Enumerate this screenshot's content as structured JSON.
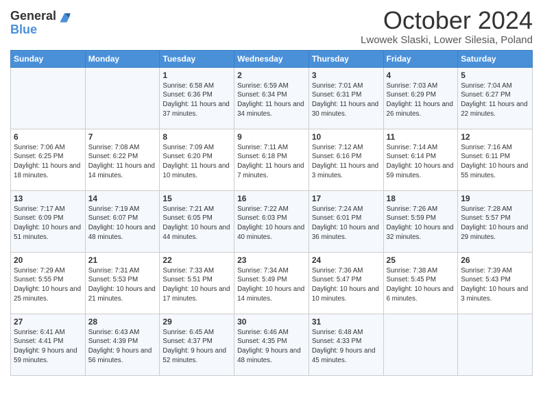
{
  "logo": {
    "general": "General",
    "blue": "Blue"
  },
  "title": "October 2024",
  "location": "Lwowek Slaski, Lower Silesia, Poland",
  "weekdays": [
    "Sunday",
    "Monday",
    "Tuesday",
    "Wednesday",
    "Thursday",
    "Friday",
    "Saturday"
  ],
  "weeks": [
    [
      {
        "day": "",
        "info": ""
      },
      {
        "day": "",
        "info": ""
      },
      {
        "day": "1",
        "info": "Sunrise: 6:58 AM\nSunset: 6:36 PM\nDaylight: 11 hours and 37 minutes."
      },
      {
        "day": "2",
        "info": "Sunrise: 6:59 AM\nSunset: 6:34 PM\nDaylight: 11 hours and 34 minutes."
      },
      {
        "day": "3",
        "info": "Sunrise: 7:01 AM\nSunset: 6:31 PM\nDaylight: 11 hours and 30 minutes."
      },
      {
        "day": "4",
        "info": "Sunrise: 7:03 AM\nSunset: 6:29 PM\nDaylight: 11 hours and 26 minutes."
      },
      {
        "day": "5",
        "info": "Sunrise: 7:04 AM\nSunset: 6:27 PM\nDaylight: 11 hours and 22 minutes."
      }
    ],
    [
      {
        "day": "6",
        "info": "Sunrise: 7:06 AM\nSunset: 6:25 PM\nDaylight: 11 hours and 18 minutes."
      },
      {
        "day": "7",
        "info": "Sunrise: 7:08 AM\nSunset: 6:22 PM\nDaylight: 11 hours and 14 minutes."
      },
      {
        "day": "8",
        "info": "Sunrise: 7:09 AM\nSunset: 6:20 PM\nDaylight: 11 hours and 10 minutes."
      },
      {
        "day": "9",
        "info": "Sunrise: 7:11 AM\nSunset: 6:18 PM\nDaylight: 11 hours and 7 minutes."
      },
      {
        "day": "10",
        "info": "Sunrise: 7:12 AM\nSunset: 6:16 PM\nDaylight: 11 hours and 3 minutes."
      },
      {
        "day": "11",
        "info": "Sunrise: 7:14 AM\nSunset: 6:14 PM\nDaylight: 10 hours and 59 minutes."
      },
      {
        "day": "12",
        "info": "Sunrise: 7:16 AM\nSunset: 6:11 PM\nDaylight: 10 hours and 55 minutes."
      }
    ],
    [
      {
        "day": "13",
        "info": "Sunrise: 7:17 AM\nSunset: 6:09 PM\nDaylight: 10 hours and 51 minutes."
      },
      {
        "day": "14",
        "info": "Sunrise: 7:19 AM\nSunset: 6:07 PM\nDaylight: 10 hours and 48 minutes."
      },
      {
        "day": "15",
        "info": "Sunrise: 7:21 AM\nSunset: 6:05 PM\nDaylight: 10 hours and 44 minutes."
      },
      {
        "day": "16",
        "info": "Sunrise: 7:22 AM\nSunset: 6:03 PM\nDaylight: 10 hours and 40 minutes."
      },
      {
        "day": "17",
        "info": "Sunrise: 7:24 AM\nSunset: 6:01 PM\nDaylight: 10 hours and 36 minutes."
      },
      {
        "day": "18",
        "info": "Sunrise: 7:26 AM\nSunset: 5:59 PM\nDaylight: 10 hours and 32 minutes."
      },
      {
        "day": "19",
        "info": "Sunrise: 7:28 AM\nSunset: 5:57 PM\nDaylight: 10 hours and 29 minutes."
      }
    ],
    [
      {
        "day": "20",
        "info": "Sunrise: 7:29 AM\nSunset: 5:55 PM\nDaylight: 10 hours and 25 minutes."
      },
      {
        "day": "21",
        "info": "Sunrise: 7:31 AM\nSunset: 5:53 PM\nDaylight: 10 hours and 21 minutes."
      },
      {
        "day": "22",
        "info": "Sunrise: 7:33 AM\nSunset: 5:51 PM\nDaylight: 10 hours and 17 minutes."
      },
      {
        "day": "23",
        "info": "Sunrise: 7:34 AM\nSunset: 5:49 PM\nDaylight: 10 hours and 14 minutes."
      },
      {
        "day": "24",
        "info": "Sunrise: 7:36 AM\nSunset: 5:47 PM\nDaylight: 10 hours and 10 minutes."
      },
      {
        "day": "25",
        "info": "Sunrise: 7:38 AM\nSunset: 5:45 PM\nDaylight: 10 hours and 6 minutes."
      },
      {
        "day": "26",
        "info": "Sunrise: 7:39 AM\nSunset: 5:43 PM\nDaylight: 10 hours and 3 minutes."
      }
    ],
    [
      {
        "day": "27",
        "info": "Sunrise: 6:41 AM\nSunset: 4:41 PM\nDaylight: 9 hours and 59 minutes."
      },
      {
        "day": "28",
        "info": "Sunrise: 6:43 AM\nSunset: 4:39 PM\nDaylight: 9 hours and 56 minutes."
      },
      {
        "day": "29",
        "info": "Sunrise: 6:45 AM\nSunset: 4:37 PM\nDaylight: 9 hours and 52 minutes."
      },
      {
        "day": "30",
        "info": "Sunrise: 6:46 AM\nSunset: 4:35 PM\nDaylight: 9 hours and 48 minutes."
      },
      {
        "day": "31",
        "info": "Sunrise: 6:48 AM\nSunset: 4:33 PM\nDaylight: 9 hours and 45 minutes."
      },
      {
        "day": "",
        "info": ""
      },
      {
        "day": "",
        "info": ""
      }
    ]
  ]
}
